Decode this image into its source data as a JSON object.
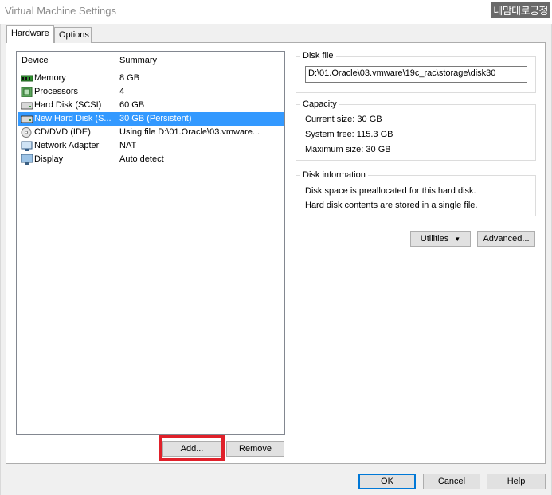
{
  "window": {
    "title": "Virtual Machine Settings",
    "watermark": "내맘대로긍정"
  },
  "tabs": [
    {
      "label": "Hardware",
      "active": true
    },
    {
      "label": "Options",
      "active": false
    }
  ],
  "device_list": {
    "headers": {
      "device": "Device",
      "summary": "Summary"
    },
    "rows": [
      {
        "device": "Memory",
        "summary": "8 GB",
        "icon": "memory-icon",
        "selected": false
      },
      {
        "device": "Processors",
        "summary": "4",
        "icon": "processor-icon",
        "selected": false
      },
      {
        "device": "Hard Disk (SCSI)",
        "summary": "60 GB",
        "icon": "hard-disk-icon",
        "selected": false
      },
      {
        "device": "New Hard Disk (S...",
        "summary": "30 GB (Persistent)",
        "icon": "hard-disk-icon",
        "selected": true
      },
      {
        "device": "CD/DVD (IDE)",
        "summary": "Using file D:\\01.Oracle\\03.vmware...",
        "icon": "cd-dvd-icon",
        "selected": false
      },
      {
        "device": "Network Adapter",
        "summary": "NAT",
        "icon": "network-adapter-icon",
        "selected": false
      },
      {
        "device": "Display",
        "summary": "Auto detect",
        "icon": "display-icon",
        "selected": false
      }
    ]
  },
  "buttons": {
    "add": "Add...",
    "remove": "Remove",
    "utilities": "Utilities",
    "advanced": "Advanced...",
    "ok": "OK",
    "cancel": "Cancel",
    "help": "Help"
  },
  "disk_file": {
    "title": "Disk file",
    "path": "D:\\01.Oracle\\03.vmware\\19c_rac\\storage\\disk30"
  },
  "capacity": {
    "title": "Capacity",
    "current_size": "Current size:  30 GB",
    "system_free": "System free:  115.3 GB",
    "maximum_size": "Maximum size:  30 GB"
  },
  "disk_information": {
    "title": "Disk information",
    "line1": "Disk space is preallocated for this hard disk.",
    "line2": "Hard disk contents are stored in a single file."
  },
  "colors": {
    "selection": "#3399ff",
    "highlight": "#e0202a",
    "default_button_border": "#0078d7"
  }
}
